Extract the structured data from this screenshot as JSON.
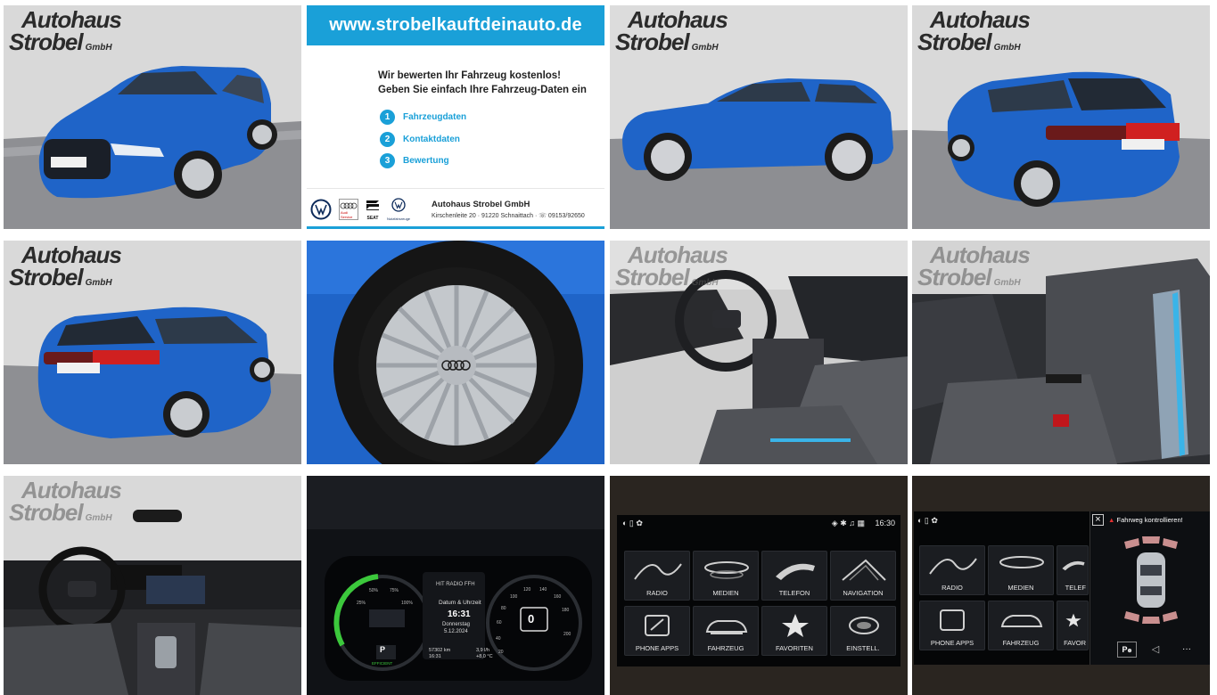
{
  "logo": {
    "line1": "Autohaus",
    "line2": "Strobel",
    "suffix": "GmbH"
  },
  "promo": {
    "banner": "www.strobelkauftdeinauto.de",
    "headline1": "Wir bewerten Ihr Fahrzeug kostenlos!",
    "headline2": "Geben Sie einfach Ihre Fahrzeug-Daten ein",
    "steps": [
      {
        "num": "1",
        "label": "Fahrzeugdaten"
      },
      {
        "num": "2",
        "label": "Kontaktdaten"
      },
      {
        "num": "3",
        "label": "Bewertung"
      }
    ],
    "dealer_name": "Autohaus Strobel GmbH",
    "dealer_address": "Kirschenleite 20 · 91220 Schnaittach · ☏ 09153/92650",
    "brand_labels": [
      "Audi Service",
      "SEAT",
      "Nutzfahrzeuge"
    ]
  },
  "cluster": {
    "speed": "0",
    "gear": "P",
    "mode": "EFFICIENT",
    "radio": "HIT RADIO FFH",
    "panel_title": "Datum & Uhrzeit",
    "time": "16:31",
    "weekday": "Donnerstag",
    "date": "5.12.2024",
    "odometer": "57302 km",
    "trip_time": "16:31",
    "consumption": "3,9 l/h",
    "temperature": "+8,0 °C",
    "scale_marks": [
      "25%",
      "50%",
      "75%",
      "100%",
      "20",
      "40",
      "60",
      "80",
      "100",
      "120",
      "140",
      "160",
      "180",
      "200"
    ]
  },
  "infotainment": {
    "clock": "16:30",
    "apps": [
      "RADIO",
      "MEDIEN",
      "TELEFON",
      "NAVIGATION",
      "PHONE APPS",
      "FAHRZEUG",
      "FAVORITEN",
      "EINSTELL."
    ]
  },
  "parking": {
    "apps": [
      "RADIO",
      "MEDIEN",
      "TELEF",
      "PHONE APPS",
      "FAHRZEUG",
      "FAVOR"
    ],
    "warning": "Fahrweg kontrollieren!",
    "more": "···"
  },
  "colors": {
    "accent": "#1aa0d8",
    "car_blue": "#1f64c8"
  }
}
